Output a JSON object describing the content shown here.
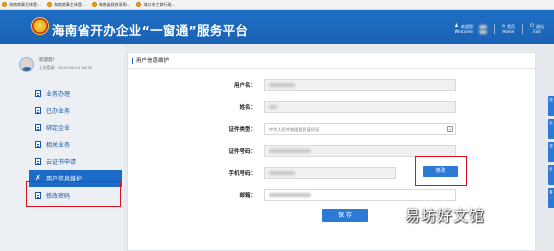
{
  "bookmarks": [
    {
      "label": "海南商事主体登..."
    },
    {
      "label": "海南商事主体登..."
    },
    {
      "label": "海南省政府采购..."
    },
    {
      "label": "海口市工商行政..."
    }
  ],
  "header": {
    "title": "海南省开办企业“一窗通”服务平台",
    "welcome_cn": "欢迎您：",
    "welcome_en": "Welcome：",
    "home_cn": "首页",
    "home_en": "Home",
    "exit_cn": "退出",
    "exit_en": "Exit"
  },
  "sidebar": {
    "welcome": "欢迎您！",
    "last_login": "上次登录：2019-09-24 16:25",
    "items": [
      {
        "label": "业务办理",
        "icon": "business-doc-icon"
      },
      {
        "label": "已办业务",
        "icon": "done-doc-icon"
      },
      {
        "label": "绑定企业",
        "icon": "bind-doc-icon"
      },
      {
        "label": "相关业务",
        "icon": "related-doc-icon"
      },
      {
        "label": "云证书申请",
        "icon": "cloud-cert-icon"
      },
      {
        "label": "用户信息维护",
        "icon": "wrench-icon",
        "active": true
      },
      {
        "label": "修改密码",
        "icon": "lock-icon"
      }
    ]
  },
  "main": {
    "title": "用户信息维护",
    "fields": {
      "username_label": "用户名：",
      "name_label": "姓名：",
      "id_type_label": "证件类型：",
      "id_type_value": "中华人民共和国居民身份证",
      "id_number_label": "证件号码：",
      "phone_label": "手机号码：",
      "email_label": "邮箱："
    },
    "edit_button": "修改",
    "save_button": "保 存"
  },
  "right_tabs": [
    "快",
    "办",
    "咨",
    "反",
    "客"
  ],
  "watermark": "易坊好文馆",
  "colors": {
    "header_blue": "#1a62b3",
    "active_nav": "#1c6bc8",
    "highlight_red": "#d8121e",
    "button_blue": "#2c7ad6"
  }
}
